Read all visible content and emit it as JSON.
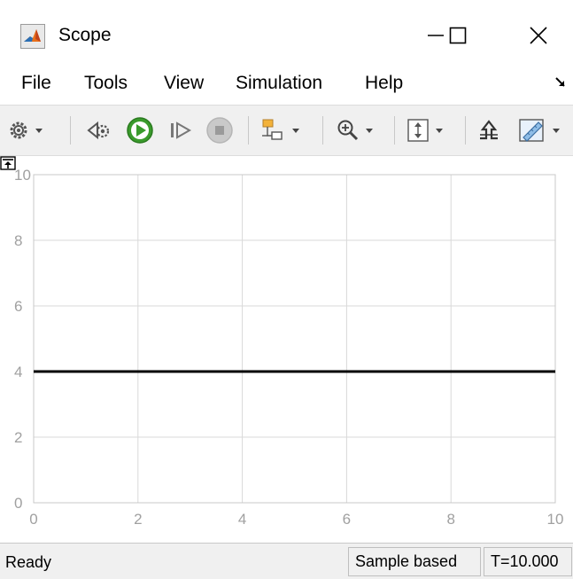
{
  "window": {
    "title": "Scope",
    "buttons": [
      "minimize",
      "maximize",
      "close"
    ]
  },
  "menubar": {
    "items": [
      {
        "label": "File"
      },
      {
        "label": "Tools"
      },
      {
        "label": "View"
      },
      {
        "label": "Simulation"
      },
      {
        "label": "Help"
      }
    ]
  },
  "toolbar": {
    "icons": [
      "settings-icon",
      "step-back-icon",
      "run-icon",
      "step-forward-icon",
      "stop-icon",
      "highlight-block-icon",
      "zoom-in-icon",
      "scale-y-axis-icon",
      "triggers-icon",
      "measurements-icon"
    ]
  },
  "chart_data": {
    "type": "line",
    "title": "",
    "xlabel": "",
    "ylabel": "",
    "xlim": [
      0,
      10
    ],
    "ylim": [
      0,
      10
    ],
    "x_ticks": [
      "0",
      "2",
      "4",
      "6",
      "8",
      "10"
    ],
    "y_ticks": [
      "0",
      "2",
      "4",
      "6",
      "8",
      "10"
    ],
    "grid": true,
    "series": [
      {
        "x": [
          0,
          10
        ],
        "y": [
          4,
          4
        ],
        "color": "#000000"
      }
    ]
  },
  "statusbar": {
    "status": "Ready",
    "mode": "Sample based",
    "time": "T=10.000"
  },
  "colors": {
    "toolbar_bg": "#f0f0f0",
    "grid": "#d9d9d9",
    "tick_label": "#a0a0a0",
    "run_green": "#3a9b2c",
    "line": "#000000"
  }
}
